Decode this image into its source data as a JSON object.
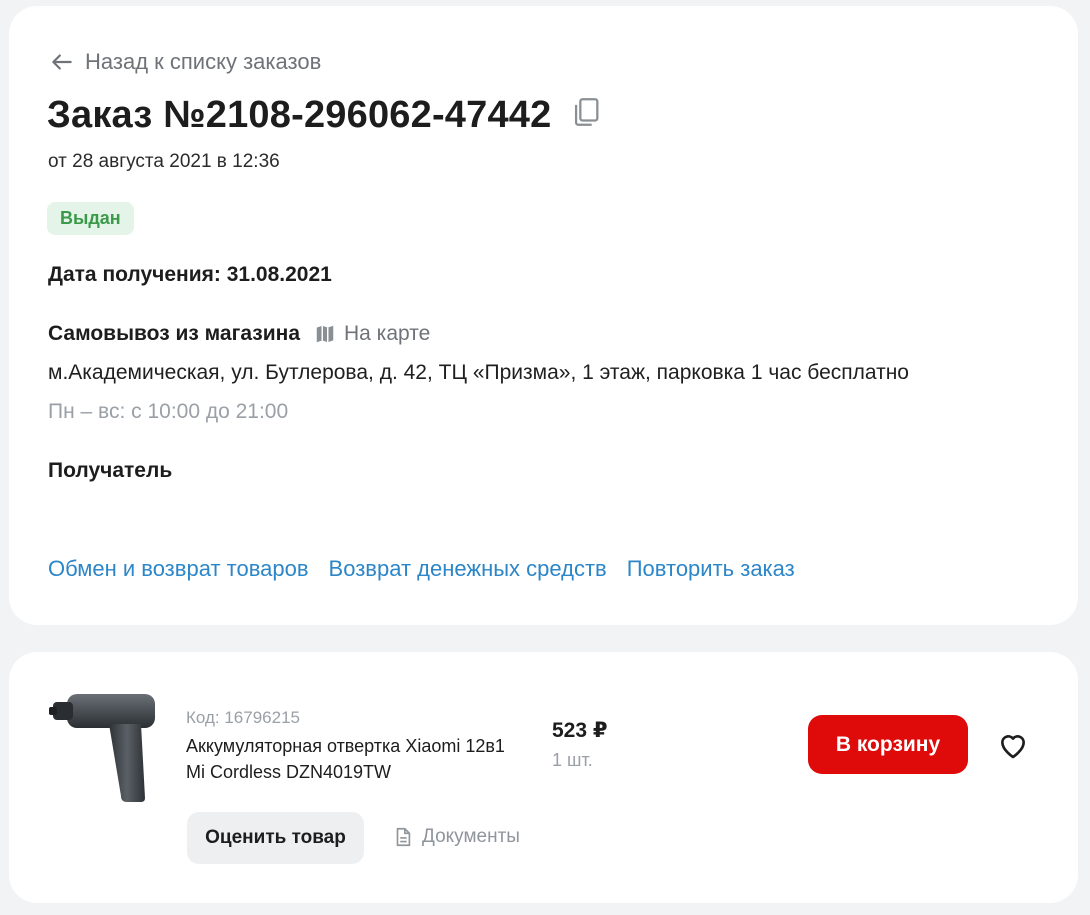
{
  "order": {
    "back_label": "Назад к списку заказов",
    "title": "Заказ №2108-296062-47442",
    "date_line": "от 28 августа 2021 в 12:36",
    "status": "Выдан",
    "receive_date": "Дата получения: 31.08.2021",
    "pickup_title": "Самовывоз из магазина",
    "map_label": "На карте",
    "address": "м.Академическая, ул. Бутлерова, д. 42, ТЦ «Призма», 1 этаж, парковка 1 час бесплатно",
    "hours": "Пн – вс: с 10:00 до 21:00",
    "recipient_label": "Получатель",
    "actions": [
      "Обмен и возврат товаров",
      "Возврат денежных средств",
      "Повторить заказ"
    ]
  },
  "item": {
    "code": "Код: 16796215",
    "name": "Аккумуляторная отвертка Xiaomi 12в1 Mi Cordless DZN4019TW",
    "price": "523 ₽",
    "qty": "1 шт.",
    "cart_label": "В корзину",
    "rate_label": "Оценить товар",
    "docs_label": "Документы"
  },
  "icons": {
    "back": "arrow-left-icon",
    "copy": "copy-icon",
    "map": "map-icon",
    "favorite": "heart-icon",
    "documents": "document-icon"
  },
  "colors": {
    "accent_red": "#df0a0a",
    "link_blue": "#2c86c7",
    "status_green": "#3a9a4a",
    "status_bg": "#e5f4e8"
  }
}
